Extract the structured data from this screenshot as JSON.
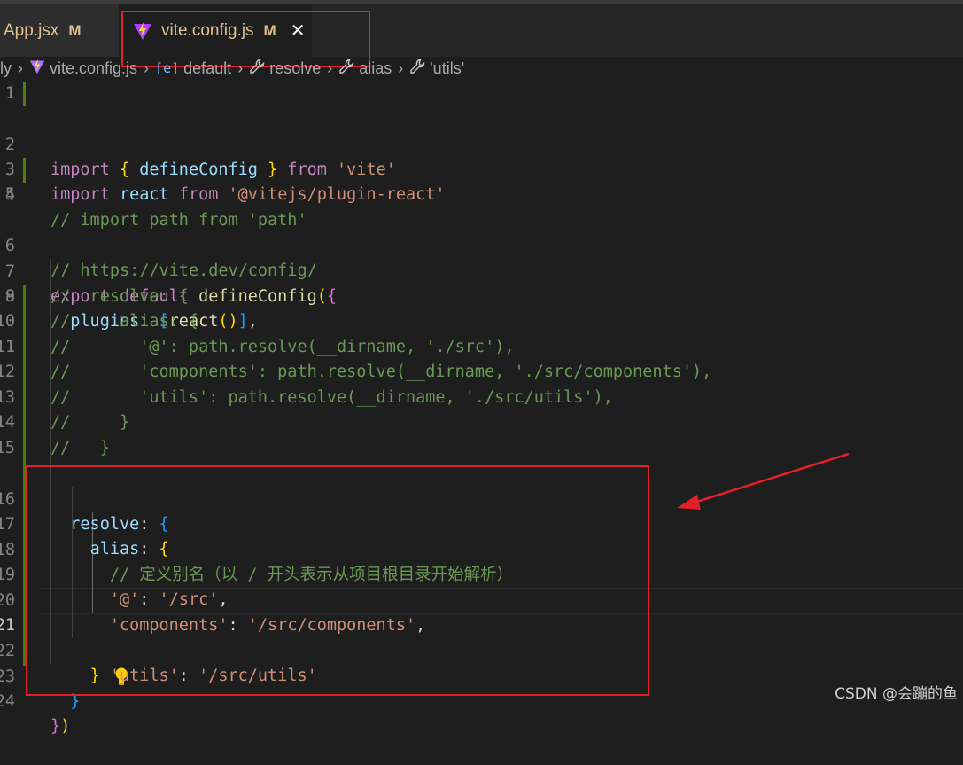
{
  "tabs": [
    {
      "label": "App.jsx",
      "status": "M"
    },
    {
      "label": "vite.config.js",
      "status": "M",
      "active": true
    }
  ],
  "breadcrumb": [
    {
      "label": "ly"
    },
    {
      "label": "vite.config.js",
      "icon": "vite-icon"
    },
    {
      "label": "default",
      "icon": "braces-icon"
    },
    {
      "label": "resolve",
      "icon": "wrench-icon"
    },
    {
      "label": "alias",
      "icon": "wrench-icon"
    },
    {
      "label": "'utils'",
      "icon": "wrench-icon"
    }
  ],
  "breadcrumb_default_icon_glyph": "[e]",
  "line_numbers": [
    "1",
    "2",
    "3",
    "4",
    "5",
    "6",
    "7",
    "8",
    "9",
    "10",
    "11",
    "12",
    "13",
    "14",
    "15",
    "16",
    "17",
    "18",
    "19",
    "20",
    "21",
    "22",
    "23",
    "24"
  ],
  "code": {
    "l2": [
      "import",
      "{",
      "defineConfig",
      "}",
      "from",
      "'vite'"
    ],
    "l3": [
      "import",
      "react",
      "from",
      "'@vitejs/plugin-react'"
    ],
    "l4": "// import path from 'path'",
    "l6_prefix": "// ",
    "l6_url": "https://vite.dev/config/",
    "l7": [
      "export",
      "default",
      "defineConfig",
      "(",
      "{"
    ],
    "l8": [
      "plugins",
      ": ",
      "[",
      "react",
      "()",
      "]",
      ","
    ],
    "l9": "//  resolve: {",
    "l10": "//     alias: {",
    "l11": "//       '@': path.resolve(__dirname, './src'),",
    "l12": "//       'components': path.resolve(__dirname, './src/components'),",
    "l13": "//       'utils': path.resolve(__dirname, './src/utils'),",
    "l14": "//     }",
    "l15": "//   }",
    "l16": [
      "resolve",
      ": ",
      "{"
    ],
    "l17": [
      "alias",
      ": ",
      "{"
    ],
    "l18": "// 定义别名（以 / 开头表示从项目根目录开始解析）",
    "l19": [
      "'@'",
      ": ",
      "'/src'",
      ","
    ],
    "l20": [
      "'components'",
      ": ",
      "'/src/components'",
      ","
    ],
    "l21": [
      "'utils'",
      ": ",
      "'/src/utils'"
    ],
    "l22": "}",
    "l23": "}",
    "l24": [
      "}",
      ")"
    ]
  },
  "current_line": "21",
  "colors": {
    "annotation_red": "#e0202a",
    "keyword": "#569cd6",
    "string": "#ce9178",
    "comment": "#6a9955",
    "modified": "#e2c08d"
  },
  "watermark": "CSDN @会蹦的鱼"
}
